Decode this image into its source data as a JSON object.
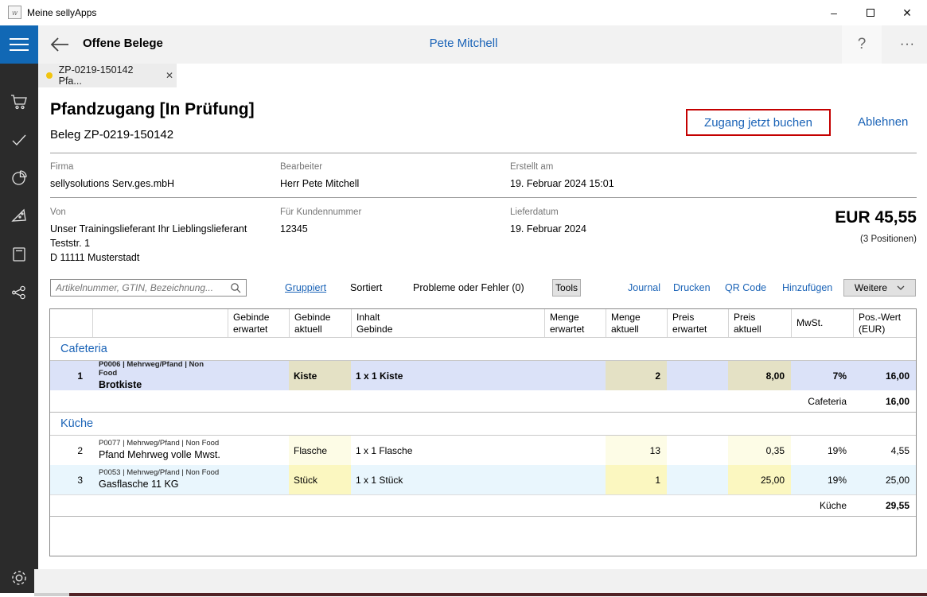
{
  "window": {
    "title": "Meine sellyApps"
  },
  "header": {
    "title": "Offene Belege",
    "user": "Pete Mitchell",
    "help_glyph": "?",
    "more_glyph": "···"
  },
  "tab": {
    "label": "ZP-0219-150142 Pfa...",
    "close_glyph": "✕"
  },
  "doc": {
    "title": "Pfandzugang [In Prüfung]",
    "subtitle": "Beleg ZP-0219-150142",
    "primary_action": "Zugang jetzt buchen",
    "secondary_action": "Ablehnen",
    "fields": {
      "firma_label": "Firma",
      "firma": "sellysolutions Serv.ges.mbH",
      "bearbeiter_label": "Bearbeiter",
      "bearbeiter": "Herr Pete Mitchell",
      "erstellt_label": "Erstellt am",
      "erstellt": "19. Februar 2024 15:01",
      "von_label": "Von",
      "von_line1": "Unser Trainingslieferant Ihr Lieblingslieferant",
      "von_line2": "Teststr. 1",
      "von_line3": "D 11111 Musterstadt",
      "kundennummer_label": "Für Kundennummer",
      "kundennummer": "12345",
      "lieferdatum_label": "Lieferdatum",
      "lieferdatum": "19. Februar 2024"
    },
    "total": "EUR 45,55",
    "positions": "(3 Positionen)"
  },
  "toolbar": {
    "search_placeholder": "Artikelnummer, GTIN, Bezeichnung...",
    "gruppiert": "Gruppiert",
    "sortiert": "Sortiert",
    "probleme": "Probleme oder Fehler (0)",
    "tools": "Tools",
    "journal": "Journal",
    "drucken": "Drucken",
    "qr_code": "QR Code",
    "hinzufuegen": "Hinzufügen",
    "weitere": "Weitere"
  },
  "table": {
    "headers": [
      "",
      "",
      "Gebinde\nerwartet",
      "Gebinde\naktuell",
      "Inhalt\nGebinde",
      "Menge\nerwartet",
      "Menge\naktuell",
      "Preis\nerwartet",
      "Preis\naktuell",
      "MwSt.",
      "Pos.-Wert\n(EUR)"
    ],
    "groups": [
      {
        "name": "Cafeteria",
        "subtotal_label": "Cafeteria",
        "subtotal_value": "16,00",
        "rows": [
          {
            "num": "1",
            "meta": "P0006 | Mehrweg/Pfand | Non Food",
            "name": "Brotkiste",
            "gebinde_aktuell": "Kiste",
            "inhalt_gebinde": "1 x 1 Kiste",
            "menge_aktuell": "2",
            "preis_aktuell": "8,00",
            "mwst": "7%",
            "pos_wert": "16,00",
            "row_bg": "#dbe2f8",
            "cell_bg": "#e4e1c5",
            "bold": true
          }
        ]
      },
      {
        "name": "Küche",
        "subtotal_label": "Küche",
        "subtotal_value": "29,55",
        "rows": [
          {
            "num": "2",
            "meta": "P0077 | Mehrweg/Pfand | Non Food",
            "name": "Pfand Mehrweg volle Mwst.",
            "gebinde_aktuell": "Flasche",
            "inhalt_gebinde": "1 x 1 Flasche",
            "menge_aktuell": "13",
            "preis_aktuell": "0,35",
            "mwst": "19%",
            "pos_wert": "4,55",
            "row_bg": "#ffffff",
            "cell_bg": "#fdfce6",
            "bold": false
          },
          {
            "num": "3",
            "meta": "P0053 | Mehrweg/Pfand | Non Food",
            "name": "Gasflasche 11 KG",
            "gebinde_aktuell": "Stück",
            "inhalt_gebinde": "1 x 1 Stück",
            "menge_aktuell": "1",
            "preis_aktuell": "25,00",
            "mwst": "19%",
            "pos_wert": "25,00",
            "row_bg": "#e9f6fd",
            "cell_bg": "#fbf7c0",
            "bold": false
          }
        ]
      }
    ]
  },
  "sidebar": {
    "icons": [
      "cart",
      "check",
      "pie-chart",
      "pizza-slice",
      "book",
      "share",
      "gear"
    ]
  },
  "colors": {
    "accent_blue": "#1a63b7",
    "annotation_red": "#c40000",
    "hamburger_blue": "#1168b5",
    "sidebar_dark": "#2b2b2b",
    "tab_dot_yellow": "#f1c40f",
    "selected_row": "#dbe2f8",
    "khaki_cell": "#e4e1c5",
    "yellow_cell_pale": "#fdfce6",
    "yellow_cell": "#fbf7c0",
    "alt_row_blue": "#e9f6fd",
    "bottom_bar_maroon": "#522226"
  }
}
